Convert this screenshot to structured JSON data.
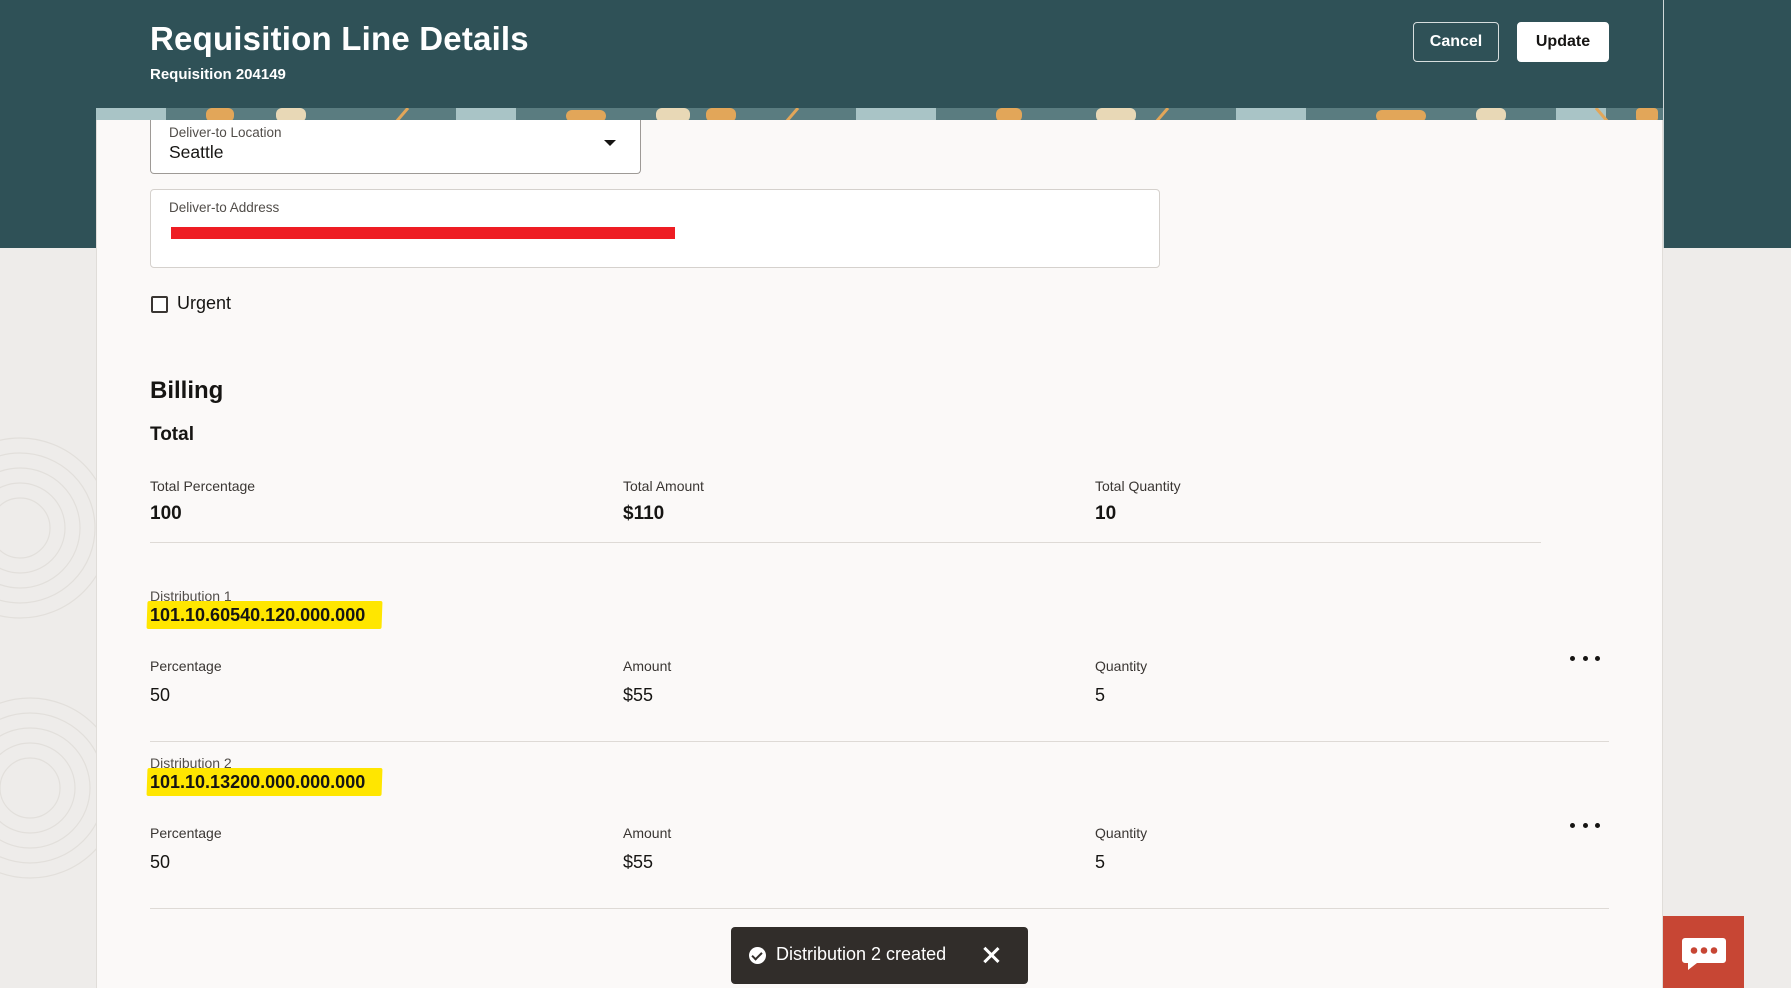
{
  "header": {
    "title": "Requisition Line Details",
    "subtitle": "Requisition 204149",
    "cancel_label": "Cancel",
    "update_label": "Update"
  },
  "colors": {
    "header_bg": "#2f5157",
    "highlight": "#ffe600",
    "redaction": "#ee1d23",
    "chat_button": "#c74634",
    "toast_bg": "#312d2a"
  },
  "delivery": {
    "location_label": "Deliver-to Location",
    "location_value": "Seattle",
    "address_label": "Deliver-to Address",
    "urgent_label": "Urgent",
    "urgent_checked": false
  },
  "billing": {
    "heading": "Billing",
    "total_heading": "Total",
    "totals": [
      {
        "label": "Total Percentage",
        "value": "100"
      },
      {
        "label": "Total Amount",
        "value": "$110"
      },
      {
        "label": "Total Quantity",
        "value": "10"
      }
    ],
    "distributions": [
      {
        "label": "Distribution 1",
        "account": "101.10.60540.120.000.000",
        "fields": [
          {
            "label": "Percentage",
            "value": "50"
          },
          {
            "label": "Amount",
            "value": "$55"
          },
          {
            "label": "Quantity",
            "value": "5"
          }
        ]
      },
      {
        "label": "Distribution 2",
        "account": "101.10.13200.000.000.000",
        "fields": [
          {
            "label": "Percentage",
            "value": "50"
          },
          {
            "label": "Amount",
            "value": "$55"
          },
          {
            "label": "Quantity",
            "value": "5"
          }
        ]
      }
    ]
  },
  "toast": {
    "message": "Distribution 2 created",
    "icon": "check-circle-icon"
  },
  "icons": {
    "dropdown": "chevron-down-icon",
    "more_actions": "more-actions-icon",
    "close": "close-icon",
    "chat": "chat-icon"
  }
}
